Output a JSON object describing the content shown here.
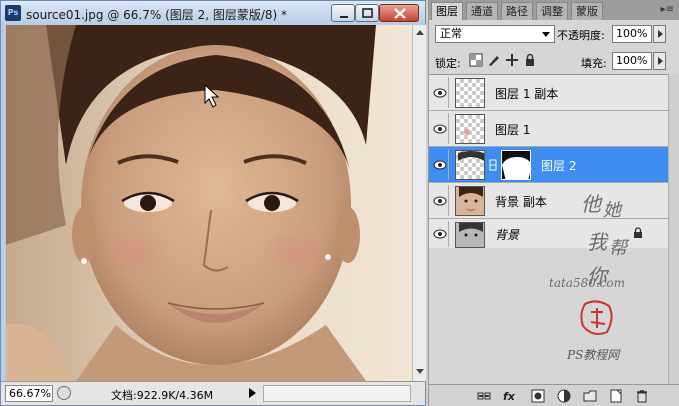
{
  "document": {
    "title": "source01.jpg @ 66.7% (图层 2, 图层蒙版/8) *",
    "zoom": "66.67%",
    "doc_info": "文档:922.9K/4.36M",
    "app_icon": "Ps"
  },
  "panel": {
    "tabs": [
      "图层",
      "通道",
      "路径",
      "调整",
      "蒙版"
    ],
    "active_tab": 0,
    "menu_glyph": "▸≡",
    "blend_mode": "正常",
    "opacity_label": "不透明度:",
    "opacity_value": "100%",
    "lock_label": "锁定:",
    "fill_label": "填充:",
    "fill_value": "100%",
    "layers": [
      {
        "name": "图层 1 副本",
        "visible": true,
        "selected": false,
        "thumb": "transparent-dot"
      },
      {
        "name": "图层 1",
        "visible": true,
        "selected": false,
        "thumb": "transparent-dot"
      },
      {
        "name": "图层 2",
        "visible": true,
        "selected": true,
        "thumb": "face-with-mask"
      },
      {
        "name": "背景 副本",
        "visible": true,
        "selected": false,
        "thumb": "face-color"
      },
      {
        "name": "背景",
        "visible": true,
        "selected": false,
        "thumb": "face-gray",
        "locked": true
      }
    ]
  },
  "watermark": {
    "line1": "他",
    "line2": "她",
    "line3": "我",
    "line4": "帮",
    "line5": "你",
    "site": "tata580.com",
    "brand": "PS教程网"
  },
  "colors": {
    "selection": "#3d8ef0",
    "panel_bg": "#d6d6d6",
    "window_frame": "#b9cde5"
  }
}
